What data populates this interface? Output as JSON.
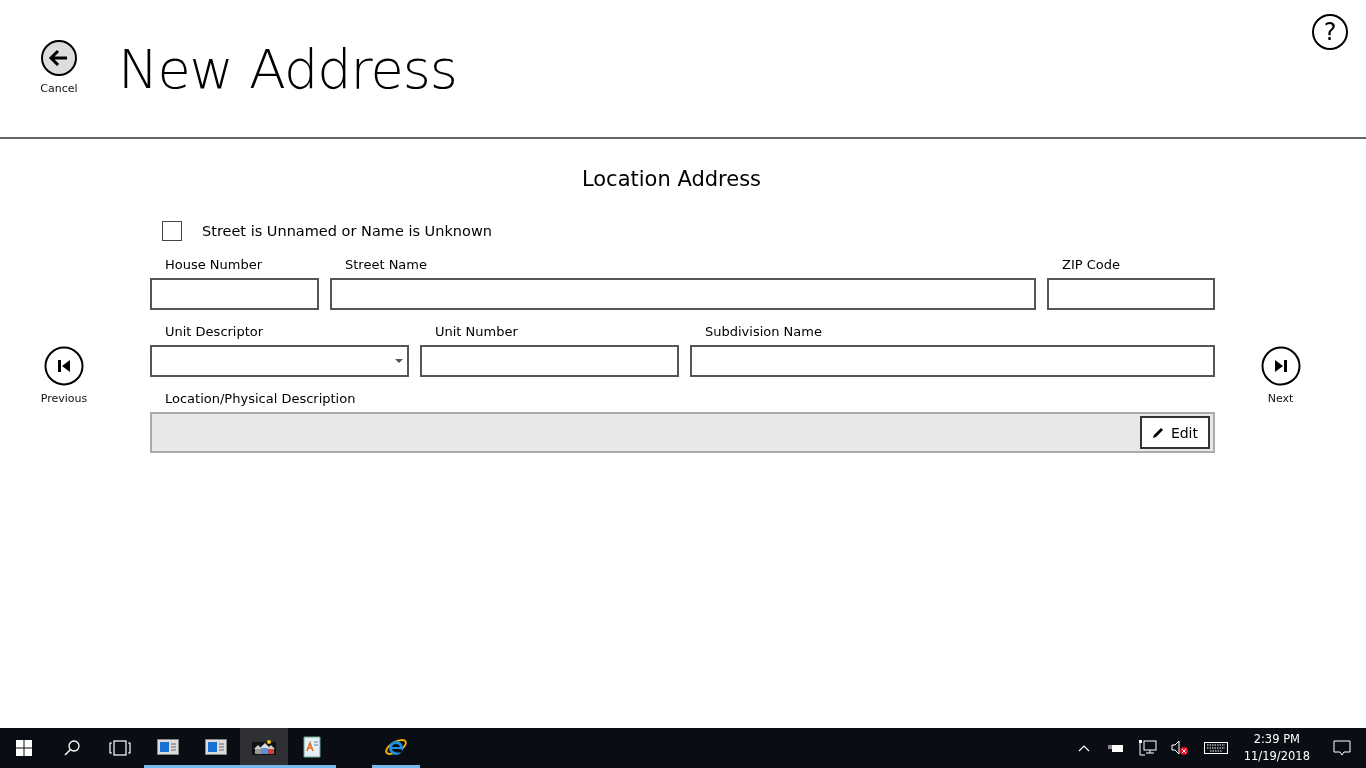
{
  "header": {
    "back_label": "Cancel",
    "title": "New Address",
    "help": "?"
  },
  "section_title": "Location Address",
  "unnamed_checkbox": {
    "label": "Street is Unnamed or Name is Unknown",
    "checked": false
  },
  "field_rows": [
    [
      {
        "kind": "text",
        "label": "House Number"
      },
      {
        "kind": "text",
        "label": "Street Name"
      },
      {
        "kind": "text",
        "label": "ZIP Code"
      }
    ],
    [
      {
        "kind": "dropdown",
        "label": "Unit Descriptor"
      },
      {
        "kind": "text",
        "label": "Unit Number"
      },
      {
        "kind": "text",
        "label": "Subdivision Name"
      }
    ]
  ],
  "description": {
    "label": "Location/Physical Description",
    "disabled": true,
    "edit_button": "Edit"
  },
  "nav": {
    "previous": "Previous",
    "next": "Next"
  },
  "taskbar": {
    "apps": [
      {
        "kind": "window",
        "running": true,
        "selected": false
      },
      {
        "kind": "window",
        "running": true,
        "selected": false
      },
      {
        "kind": "houses",
        "running": true,
        "selected": true
      },
      {
        "kind": "notepad",
        "running": true,
        "selected": false
      },
      {
        "kind": "browser",
        "running": true,
        "selected": false
      }
    ],
    "time": "2:39 PM",
    "date": "11/19/2018"
  }
}
